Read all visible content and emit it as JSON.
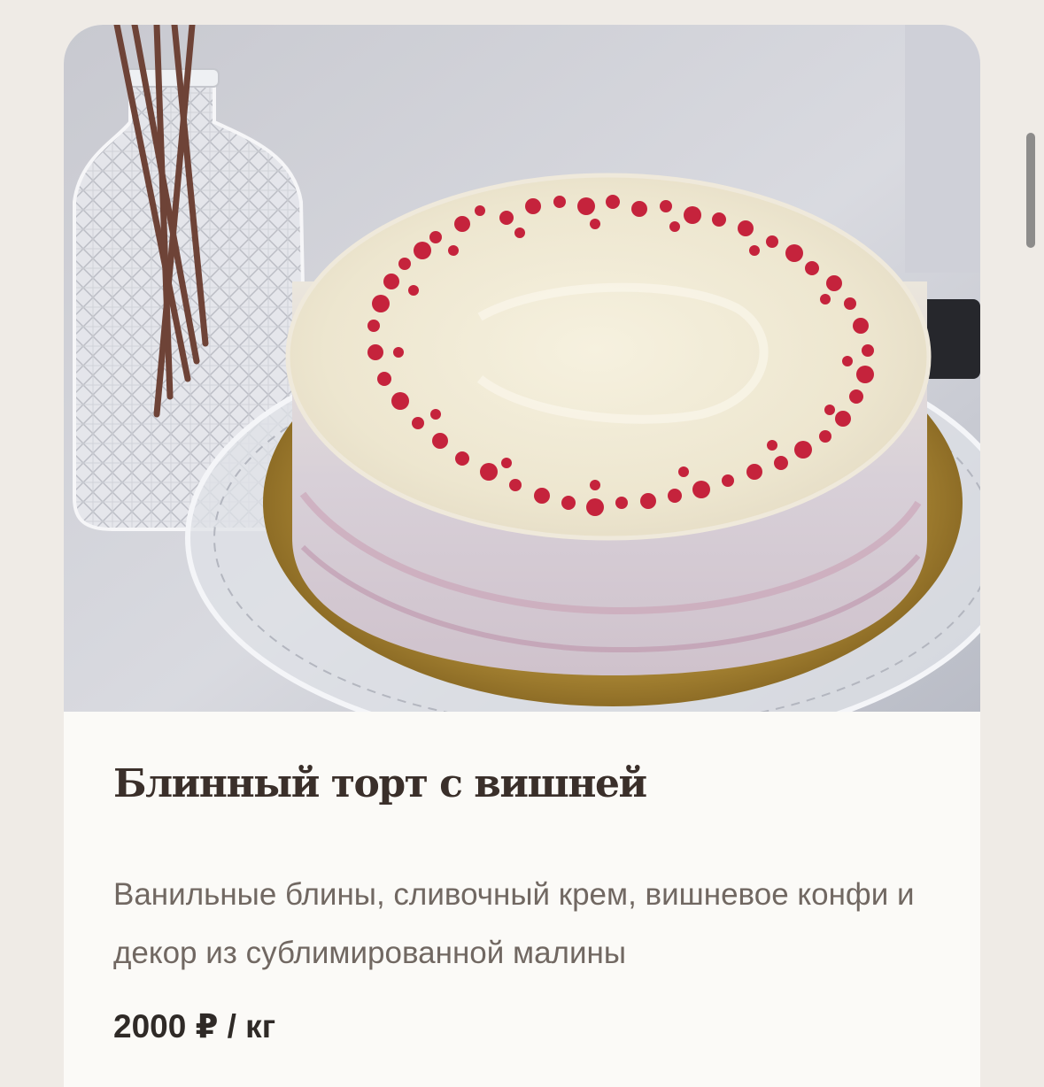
{
  "product": {
    "title": "Блинный торт с вишней",
    "description": "Ванильные блины, сливочный крем, вишневое конфи и декор из сублимированной малины",
    "price": "2000 ₽ / кг"
  }
}
